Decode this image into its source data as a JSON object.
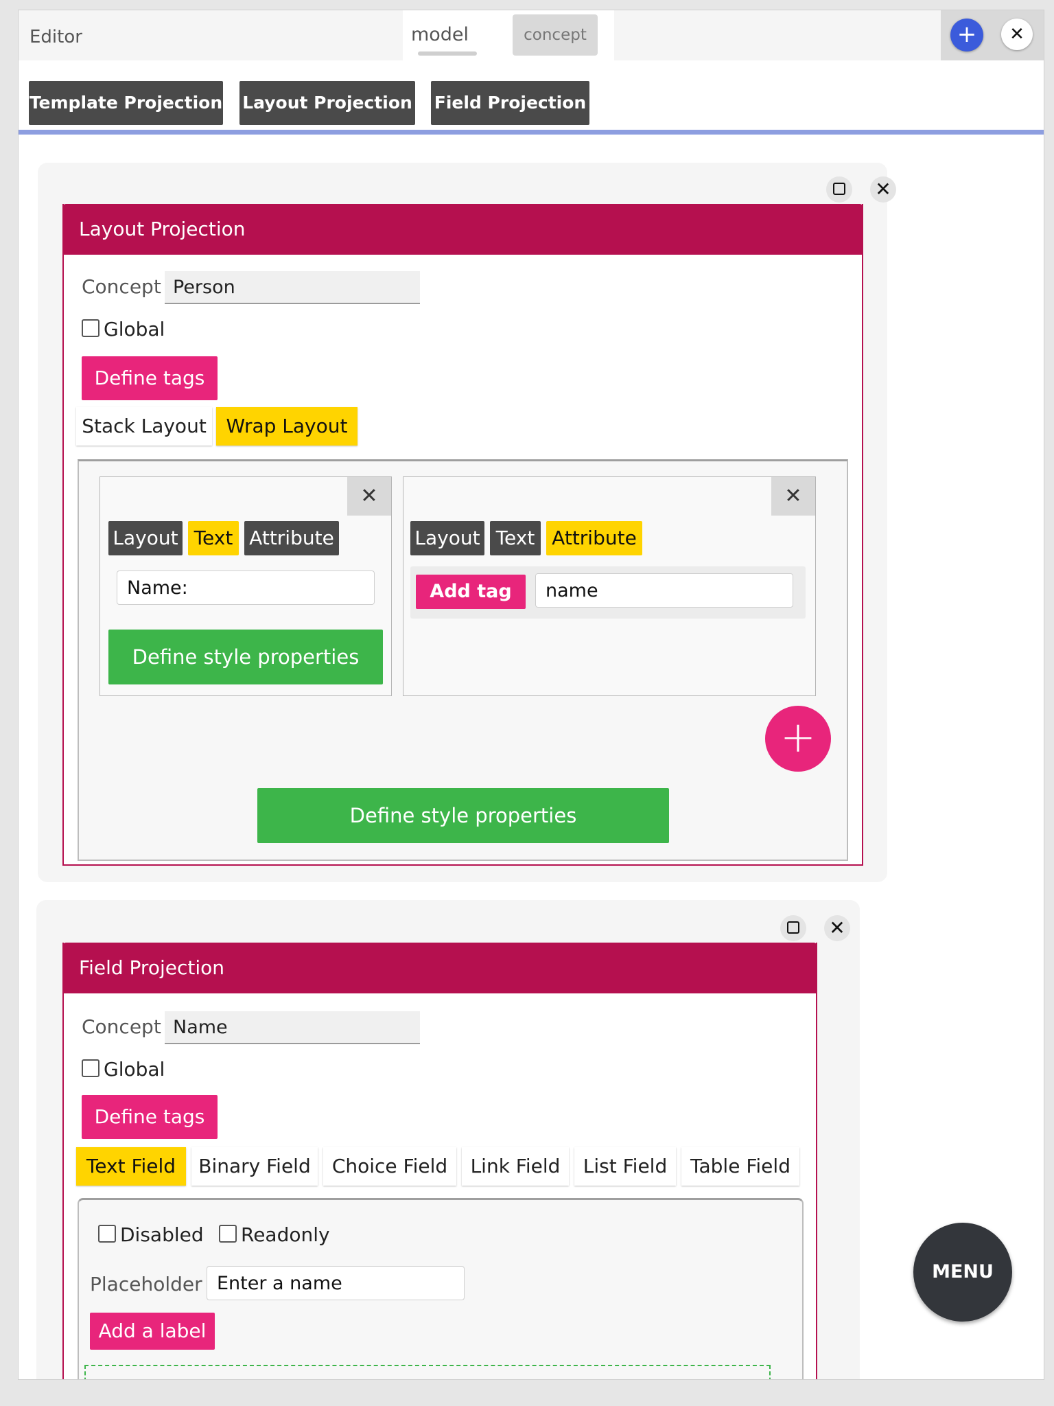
{
  "header": {
    "title": "Editor",
    "tabs": [
      {
        "label": "model",
        "active": true
      },
      {
        "label": "concept",
        "active": false
      }
    ],
    "add_icon": "plus-icon",
    "close_icon": "close-icon"
  },
  "toolbar": {
    "buttons": [
      "Template Projection",
      "Layout Projection",
      "Field Projection"
    ]
  },
  "layout_projection": {
    "title": "Layout Projection",
    "concept_label": "Concept",
    "concept_value": "Person",
    "global_label": "Global",
    "global_checked": false,
    "define_tags": "Define tags",
    "layout_options": [
      {
        "label": "Stack Layout",
        "selected": false
      },
      {
        "label": "Wrap Layout",
        "selected": true
      }
    ],
    "cells": [
      {
        "tabs": [
          "Layout",
          "Text",
          "Attribute"
        ],
        "selected_tab": "Text",
        "text_value": "Name:",
        "style_button": "Define style properties"
      },
      {
        "tabs": [
          "Layout",
          "Text",
          "Attribute"
        ],
        "selected_tab": "Attribute",
        "add_tag": "Add tag",
        "attribute_value": "name"
      }
    ],
    "add_button": "+",
    "style_button": "Define style properties"
  },
  "field_projection": {
    "title": "Field Projection",
    "concept_label": "Concept",
    "concept_value": "Name",
    "global_label": "Global",
    "global_checked": false,
    "define_tags": "Define tags",
    "field_types": [
      {
        "label": "Text Field",
        "selected": true
      },
      {
        "label": "Binary Field",
        "selected": false
      },
      {
        "label": "Choice Field",
        "selected": false
      },
      {
        "label": "Link Field",
        "selected": false
      },
      {
        "label": "List Field",
        "selected": false
      },
      {
        "label": "Table Field",
        "selected": false
      }
    ],
    "disabled_label": "Disabled",
    "readonly_label": "Readonly",
    "placeholder_label": "Placeholder",
    "placeholder_value": "Enter a name",
    "add_label": "Add a label"
  },
  "menu_button": "MENU",
  "colors": {
    "accent_pink": "#e8257b",
    "header_magenta": "#b5104f",
    "selected_yellow": "#ffd400",
    "green": "#3db54a",
    "dark_button": "#4a4a4a",
    "add_blue": "#3b5bdb"
  }
}
